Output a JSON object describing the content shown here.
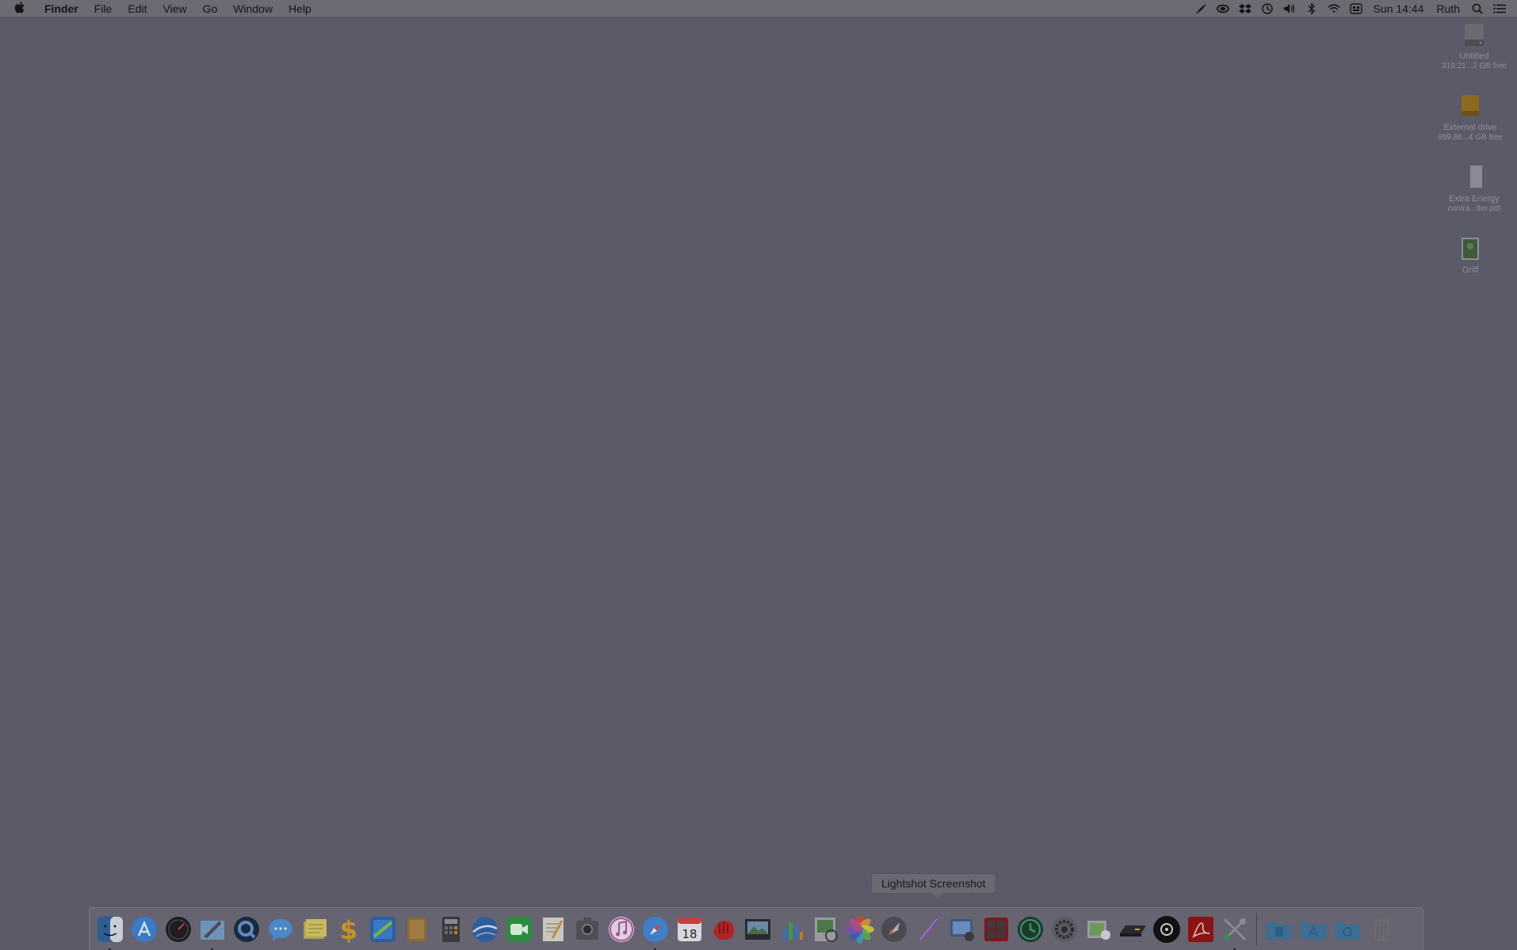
{
  "menubar": {
    "apple": "",
    "app_name": "Finder",
    "menus": [
      "File",
      "Edit",
      "View",
      "Go",
      "Window",
      "Help"
    ],
    "status_icons": [
      "quill-icon",
      "cloud-icon",
      "dropbox-icon",
      "time-machine-icon",
      "volume-icon",
      "bluetooth-icon",
      "wifi-icon",
      "input-source-icon"
    ],
    "clock": "Sun 14:44",
    "user": "Ruth"
  },
  "desktop": {
    "icons": [
      {
        "name": "Untitled",
        "sub": "319.21...2 GB free",
        "icon": "hard-drive-icon"
      },
      {
        "name": "External drive",
        "sub": "999.86...4 GB free",
        "icon": "external-drive-icon"
      },
      {
        "name": "Extra Energy",
        "sub": "contra...tter.pdf",
        "icon": "pdf-document-icon"
      },
      {
        "name": "Griff",
        "sub": "",
        "icon": "image-file-icon"
      }
    ]
  },
  "dock": {
    "tooltip": "Lightshot Screenshot",
    "apps": [
      "finder-icon",
      "app-store-icon",
      "dashboard-icon",
      "mail-icon",
      "quicktime-icon",
      "messages-icon",
      "stickies-icon",
      "dollar-app-icon",
      "screen-app-icon",
      "notebook-icon",
      "calculator-icon",
      "google-earth-icon",
      "facetime-icon",
      "textedit-icon",
      "image-capture-icon",
      "itunes-icon",
      "safari-icon",
      "calendar-icon",
      "hand-app-icon",
      "photo-editor-icon",
      "numbers-icon",
      "preview-icon",
      "photos-icon",
      "launchpad-icon",
      "lightshot-icon",
      "image-viewer-icon",
      "photo-booth-icon",
      "time-machine-icon",
      "system-preferences-icon",
      "directory-utility-icon",
      "drive-app-icon",
      "dvd-player-icon",
      "acrobat-icon",
      "utilities-icon"
    ],
    "calendar_day": "18",
    "folders": [
      "documents-folder-icon",
      "applications-folder-icon",
      "downloads-folder-icon",
      "trash-icon"
    ]
  }
}
